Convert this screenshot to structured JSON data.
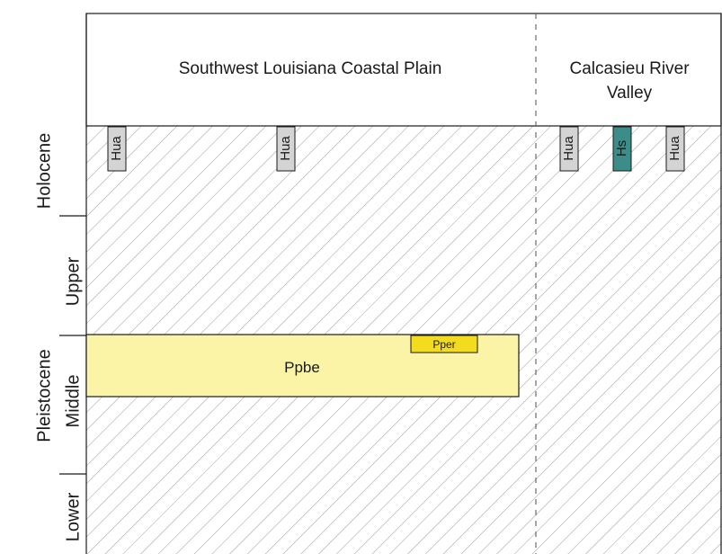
{
  "columns": {
    "left_title": "Southwest Louisiana Coastal Plain",
    "right_title_line1": "Calcasieu River",
    "right_title_line2": "Valley"
  },
  "time_scale": {
    "holocene": "Holocene",
    "pleistocene": "Pleistocene",
    "upper": "Upper",
    "middle": "Middle",
    "lower": "Lower"
  },
  "units": {
    "hua_labels": [
      "Hua",
      "Hua",
      "Hua",
      "Hua"
    ],
    "hs": "Hs",
    "ppbe": "Ppbe",
    "pper": "Pper"
  },
  "colors": {
    "hua_fill": "#d4d4d4",
    "hs_fill": "#3c8c8a",
    "ppbe_fill": "#fbf3a6",
    "pper_fill": "#f3dc1e",
    "hatch": "#9a9a9a"
  }
}
